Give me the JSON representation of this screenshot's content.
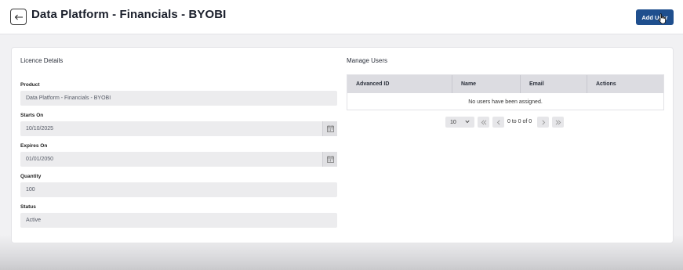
{
  "header": {
    "title": "Data Platform - Financials - BYOBI",
    "add_user_label": "Add User"
  },
  "licence": {
    "section_title": "Licence Details",
    "fields": [
      {
        "label": "Product",
        "value": "Data Platform - Financials - BYOBI",
        "has_calendar": false
      },
      {
        "label": "Starts On",
        "value": "10/10/2025",
        "has_calendar": true
      },
      {
        "label": "Expires On",
        "value": "01/01/2050",
        "has_calendar": true
      },
      {
        "label": "Quantity",
        "value": "100",
        "has_calendar": false
      },
      {
        "label": "Status",
        "value": "Active",
        "has_calendar": false
      }
    ]
  },
  "users": {
    "section_title": "Manage Users",
    "columns": [
      "Advanced ID",
      "Name",
      "Email",
      "Actions"
    ],
    "empty_message": "No users have been assigned.",
    "pagination": {
      "page_size": "10",
      "range_text": "0 to 0 of 0"
    }
  },
  "colors": {
    "primary": "#1f4f8e",
    "table_header": "#dcdce1",
    "field_bg": "#ececee"
  }
}
